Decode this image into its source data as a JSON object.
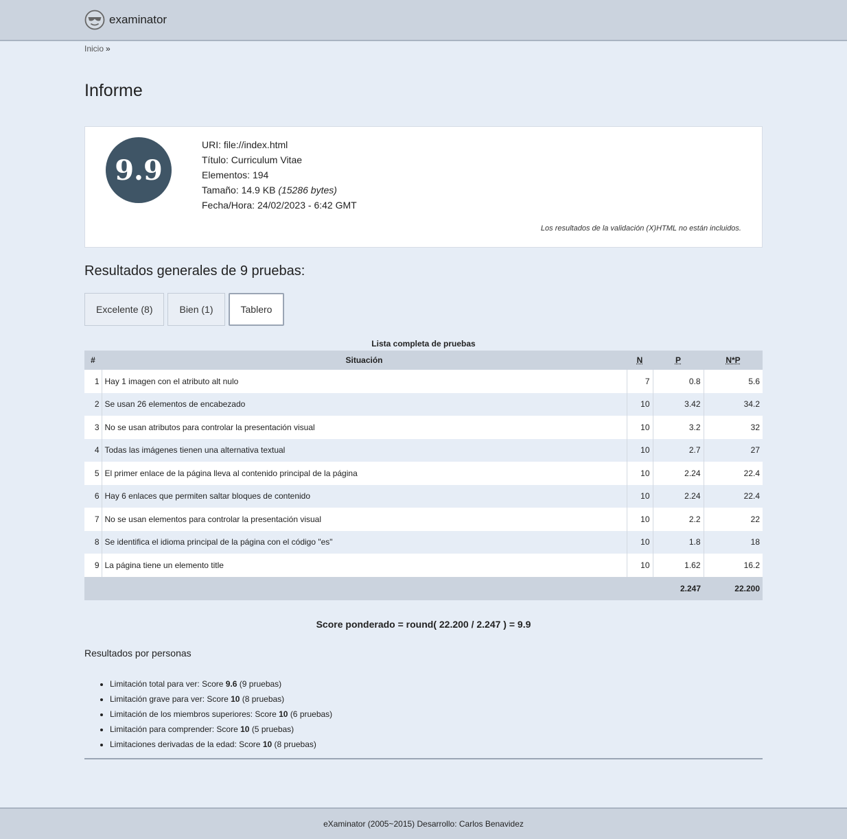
{
  "header": {
    "brand": "examinator",
    "logo_icon": "sunglasses-face-icon"
  },
  "breadcrumb": {
    "home": "Inicio",
    "separator": "»"
  },
  "page_title": "Informe",
  "summary": {
    "score": "9.9",
    "uri_label": "URI:",
    "uri": "file://index.html",
    "title_label": "Título:",
    "title": "Curriculum Vitae",
    "elements_label": "Elementos:",
    "elements": "194",
    "size_label": "Tamaño:",
    "size": "14.9 KB",
    "size_bytes": "(15286 bytes)",
    "datetime_label": "Fecha/Hora:",
    "datetime": "24/02/2023 - 6:42 GMT",
    "note": "Los resultados de la validación (X)HTML no están incluidos."
  },
  "results_title": "Resultados generales de 9 pruebas:",
  "tabs": [
    {
      "label": "Excelente (8)"
    },
    {
      "label": "Bien (1)"
    },
    {
      "label": "Tablero"
    }
  ],
  "table": {
    "caption": "Lista completa de pruebas",
    "headers": {
      "num": "#",
      "situation": "Situación",
      "n": "N",
      "p": "P",
      "np": "N*P"
    },
    "rows": [
      {
        "num": "1",
        "situation": "Hay 1 imagen con el atributo alt nulo",
        "n": "7",
        "p": "0.8",
        "np": "5.6"
      },
      {
        "num": "2",
        "situation": "Se usan 26 elementos de encabezado",
        "n": "10",
        "p": "3.42",
        "np": "34.2"
      },
      {
        "num": "3",
        "situation": "No se usan atributos para controlar la presentación visual",
        "n": "10",
        "p": "3.2",
        "np": "32"
      },
      {
        "num": "4",
        "situation": "Todas las imágenes tienen una alternativa textual",
        "n": "10",
        "p": "2.7",
        "np": "27"
      },
      {
        "num": "5",
        "situation": "El primer enlace de la página lleva al contenido principal de la página",
        "n": "10",
        "p": "2.24",
        "np": "22.4"
      },
      {
        "num": "6",
        "situation": "Hay 6 enlaces que permiten saltar bloques de contenido",
        "n": "10",
        "p": "2.24",
        "np": "22.4"
      },
      {
        "num": "7",
        "situation": "No se usan elementos para controlar la presentación visual",
        "n": "10",
        "p": "2.2",
        "np": "22"
      },
      {
        "num": "8",
        "situation": "Se identifica el idioma principal de la página con el código \"es\"",
        "n": "10",
        "p": "1.8",
        "np": "18"
      },
      {
        "num": "9",
        "situation": "La página tiene un elemento title",
        "n": "10",
        "p": "1.62",
        "np": "16.2"
      }
    ],
    "totals": {
      "p": "2.247",
      "np": "22.200"
    }
  },
  "score_formula": "Score ponderado = round( 22.200 / 2.247 ) = 9.9",
  "personas": {
    "title": "Resultados por personas",
    "items": [
      {
        "label": "Limitación total para ver: Score",
        "score": "9.6",
        "tests": "(9 pruebas)"
      },
      {
        "label": "Limitación grave para ver: Score",
        "score": "10",
        "tests": "(8 pruebas)"
      },
      {
        "label": "Limitación de los miembros superiores: Score",
        "score": "10",
        "tests": "(6 pruebas)"
      },
      {
        "label": "Limitación para comprender: Score",
        "score": "10",
        "tests": "(5 pruebas)"
      },
      {
        "label": "Limitaciones derivadas de la edad: Score",
        "score": "10",
        "tests": "(8 pruebas)"
      }
    ]
  },
  "footer": {
    "text": "eXaminator (2005~2015) Desarrollo: Carlos Benavidez"
  }
}
